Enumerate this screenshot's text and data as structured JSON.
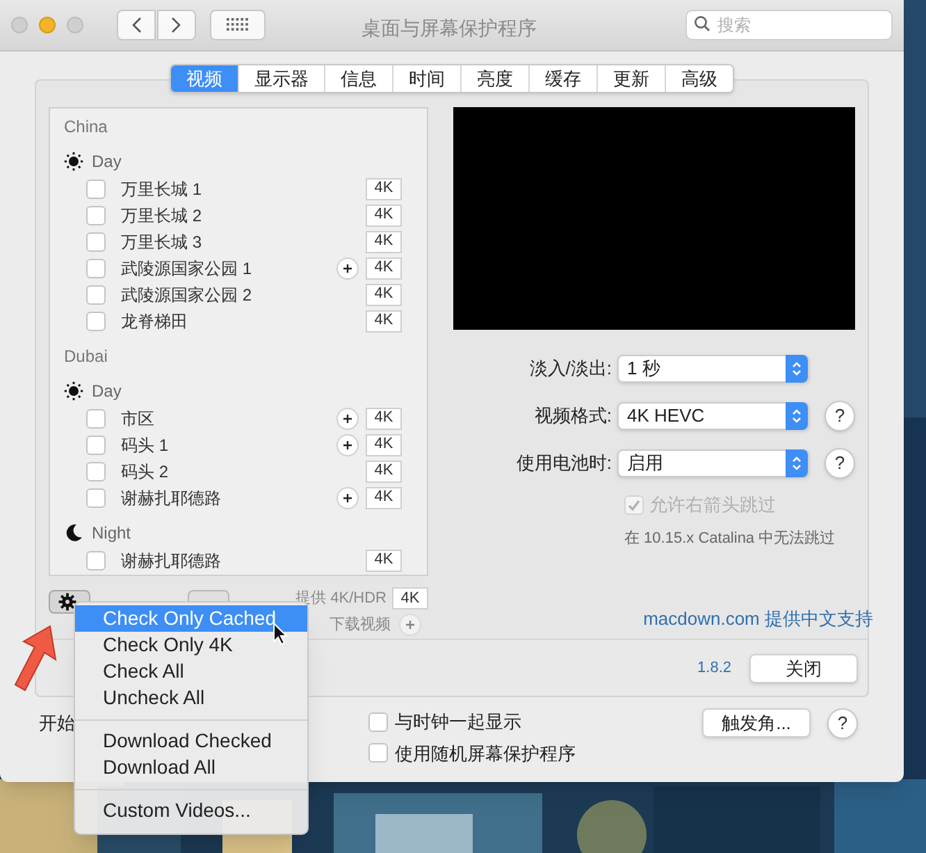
{
  "window": {
    "title": "桌面与屏幕保护程序",
    "search_placeholder": "搜索"
  },
  "tabs": [
    {
      "label": "视频",
      "selected": true
    },
    {
      "label": "显示器",
      "selected": false
    },
    {
      "label": "信息",
      "selected": false
    },
    {
      "label": "时间",
      "selected": false
    },
    {
      "label": "亮度",
      "selected": false
    },
    {
      "label": "缓存",
      "selected": false
    },
    {
      "label": "更新",
      "selected": false
    },
    {
      "label": "高级",
      "selected": false
    }
  ],
  "video_list": [
    {
      "place": "China",
      "sections": [
        {
          "kind": "day",
          "label": "Day",
          "items": [
            {
              "label": "万里长城 1",
              "checked": false,
              "downloadable": false,
              "badge": "4K"
            },
            {
              "label": "万里长城 2",
              "checked": false,
              "downloadable": false,
              "badge": "4K"
            },
            {
              "label": "万里长城 3",
              "checked": false,
              "downloadable": false,
              "badge": "4K"
            },
            {
              "label": "武陵源国家公园 1",
              "checked": false,
              "downloadable": true,
              "badge": "4K"
            },
            {
              "label": "武陵源国家公园 2",
              "checked": false,
              "downloadable": false,
              "badge": "4K"
            },
            {
              "label": "龙脊梯田",
              "checked": false,
              "downloadable": false,
              "badge": "4K"
            }
          ]
        }
      ]
    },
    {
      "place": "Dubai",
      "sections": [
        {
          "kind": "day",
          "label": "Day",
          "items": [
            {
              "label": "市区",
              "checked": false,
              "downloadable": true,
              "badge": "4K"
            },
            {
              "label": "码头 1",
              "checked": false,
              "downloadable": true,
              "badge": "4K"
            },
            {
              "label": "码头 2",
              "checked": false,
              "downloadable": false,
              "badge": "4K"
            },
            {
              "label": "谢赫扎耶德路",
              "checked": false,
              "downloadable": true,
              "badge": "4K"
            }
          ]
        },
        {
          "kind": "night",
          "label": "Night",
          "items": [
            {
              "label": "谢赫扎耶德路",
              "checked": false,
              "downloadable": false,
              "badge": "4K"
            }
          ]
        }
      ]
    }
  ],
  "list_footer": {
    "hdr_label": "提供 4K/HDR",
    "hdr_badge": "4K",
    "download_label": "下载视频"
  },
  "settings": [
    {
      "label": "淡入/淡出:",
      "value": "1 秒"
    },
    {
      "label": "视频格式:",
      "value": "4K HEVC",
      "help": "?"
    },
    {
      "label": "使用电池时:",
      "value": "启用",
      "help": "?"
    }
  ],
  "skip_option": {
    "label": "允许右箭头跳过",
    "checked": true,
    "disabled": true
  },
  "skip_note": "在 10.15.x Catalina 中无法跳过",
  "support_link": "macdown.com 提供中文支持",
  "version": "1.8.2",
  "close_button": "关闭",
  "footer": {
    "start_label": "开始",
    "options": [
      {
        "label": "与时钟一起显示",
        "checked": false
      },
      {
        "label": "使用随机屏幕保护程序",
        "checked": false
      }
    ],
    "corners_button": "触发角...",
    "help": "?"
  },
  "menu": [
    {
      "kind": "item",
      "label": "Check Only Cached",
      "selected": true
    },
    {
      "kind": "item",
      "label": "Check Only 4K",
      "selected": false
    },
    {
      "kind": "item",
      "label": "Check All",
      "selected": false
    },
    {
      "kind": "item",
      "label": "Uncheck All",
      "selected": false
    },
    {
      "kind": "separator"
    },
    {
      "kind": "item",
      "label": "Download Checked",
      "selected": false
    },
    {
      "kind": "item",
      "label": "Download All",
      "selected": false
    },
    {
      "kind": "separator"
    },
    {
      "kind": "item",
      "label": "Custom Videos...",
      "selected": false
    }
  ]
}
